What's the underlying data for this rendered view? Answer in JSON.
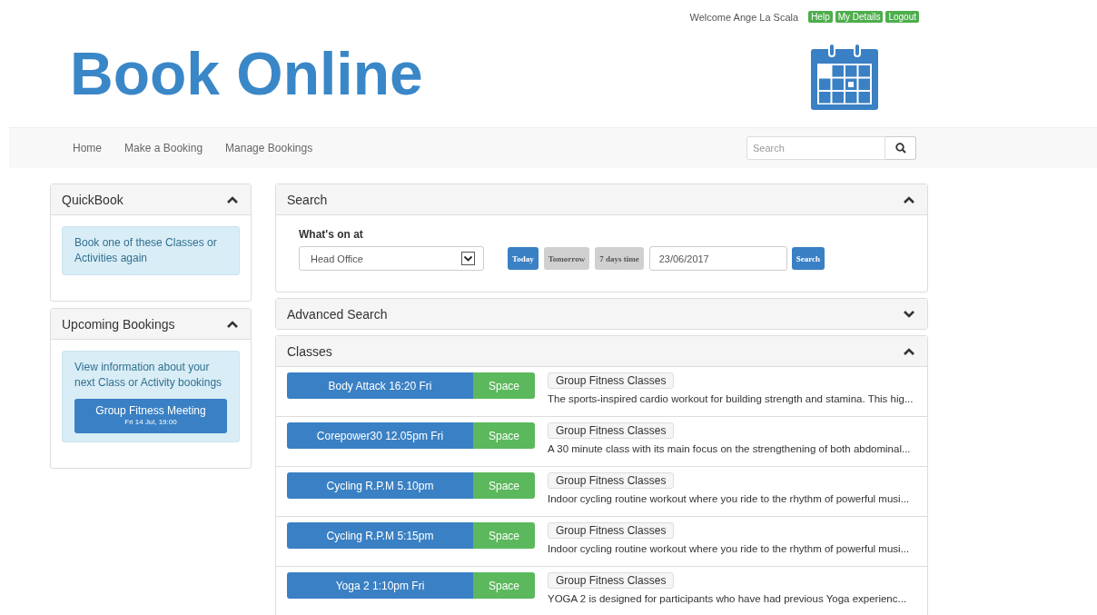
{
  "top_bar": {
    "welcome": "Welcome Ange La Scala",
    "links": [
      "Help",
      "My Details",
      "Logout"
    ]
  },
  "header": {
    "title": "Book Online"
  },
  "nav": {
    "items": [
      "Home",
      "Make a Booking",
      "Manage Bookings"
    ],
    "search": {
      "placeholder": "Search"
    }
  },
  "quickbook": {
    "title": "QuickBook",
    "expanded": true,
    "info": "Book one of these Classes or Activities again"
  },
  "upcoming": {
    "title": "Upcoming Bookings",
    "expanded": true,
    "info": "View information about your next Class or Activity bookings",
    "booking": {
      "name": "Group Fitness Meeting",
      "when": "Fri 14 Jul, 19:00"
    }
  },
  "search_panel": {
    "title": "Search",
    "expanded": true,
    "label": "What's on at",
    "location": "Head Office",
    "days": [
      {
        "label": "Today",
        "selected": true
      },
      {
        "label": "Tomorrow",
        "selected": false
      },
      {
        "label": "7 days time",
        "selected": false
      }
    ],
    "date": "23/06/2017",
    "button": "Search"
  },
  "advanced_search": {
    "title": "Advanced Search",
    "expanded": false
  },
  "classes": {
    "title": "Classes",
    "expanded": true,
    "rows": [
      {
        "name": "Body Attack 16:20 Fri",
        "availability": "Space",
        "category": "Group Fitness Classes",
        "description": "The sports-inspired cardio workout for building strength and stamina. This hig..."
      },
      {
        "name": "Corepower30 12.05pm Fri",
        "availability": "Space",
        "category": "Group Fitness Classes",
        "description": "A 30 minute class with its main focus on the strengthening of both abdominal..."
      },
      {
        "name": "Cycling R.P.M 5.10pm",
        "availability": "Space",
        "category": "Group Fitness Classes",
        "description": "Indoor cycling routine workout where you ride to the rhythm of powerful musi..."
      },
      {
        "name": "Cycling R.P.M 5:15pm",
        "availability": "Space",
        "category": "Group Fitness Classes",
        "description": "Indoor cycling routine workout where you ride to the rhythm of powerful musi..."
      },
      {
        "name": "Yoga 2 1:10pm Fri",
        "availability": "Space",
        "category": "Group Fitness Classes",
        "description": "YOGA 2 is designed for participants who have had previous Yoga experienc..."
      }
    ]
  }
}
